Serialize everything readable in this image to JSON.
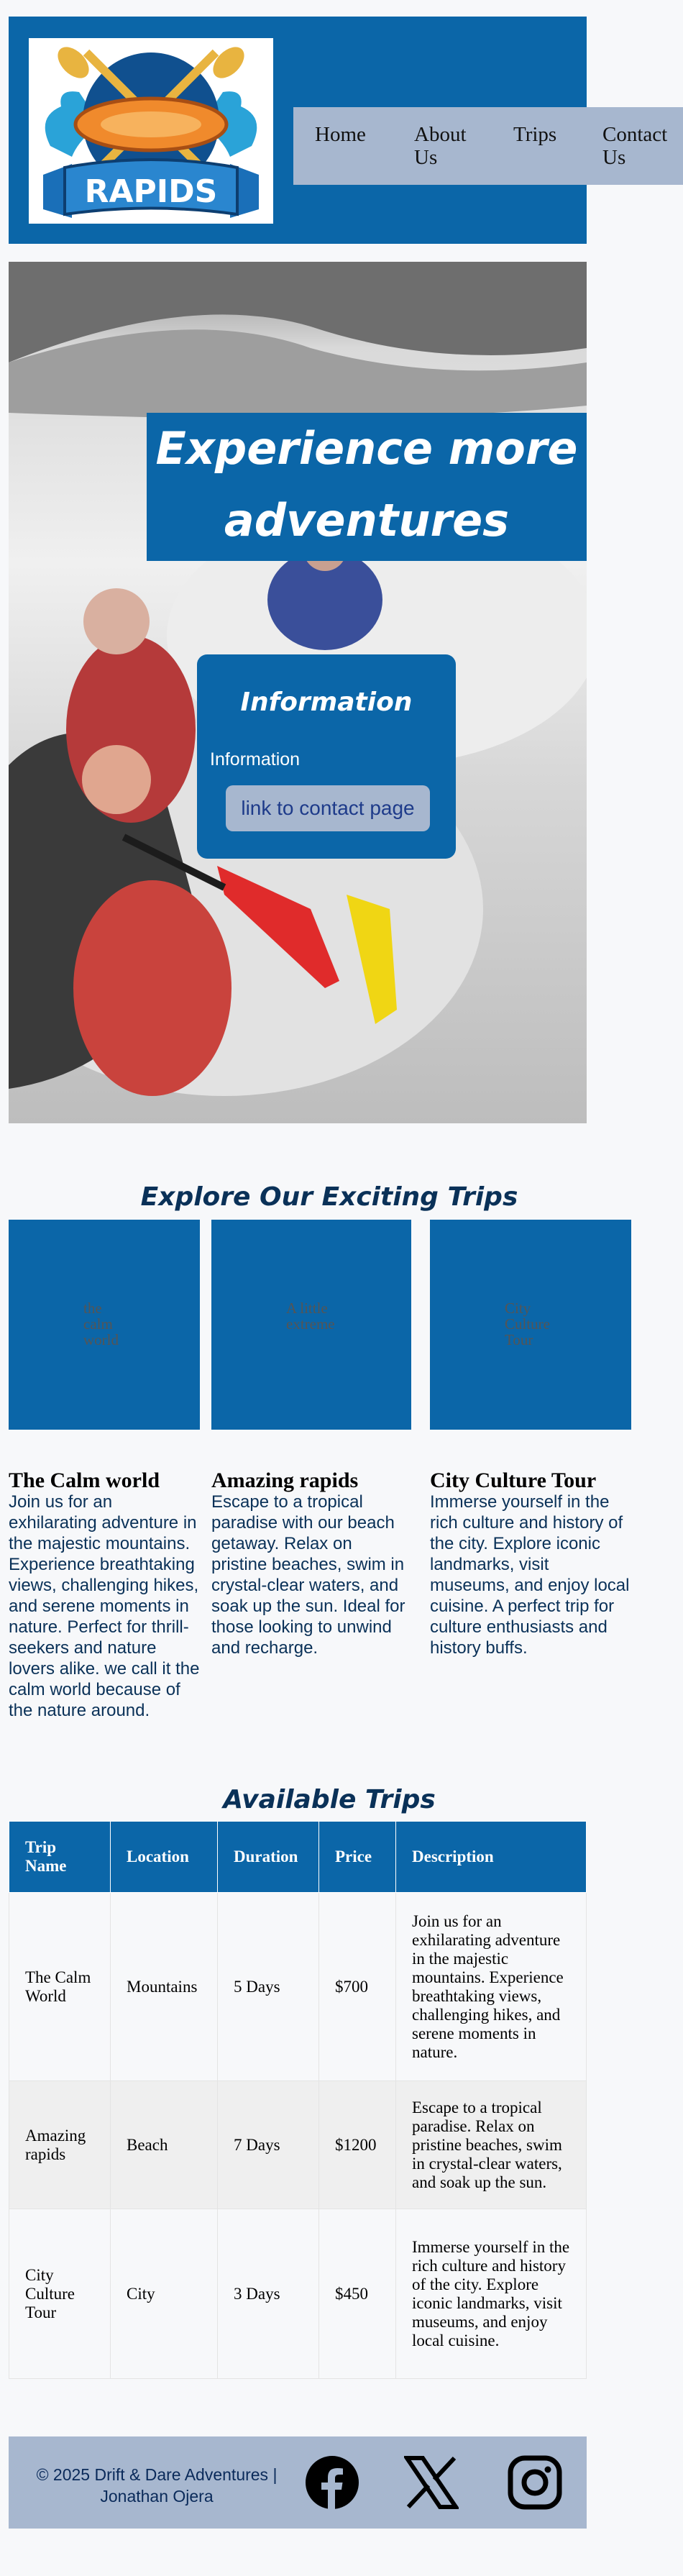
{
  "header": {
    "logo_text": "RAPIDS",
    "nav": [
      "Home",
      "About Us",
      "Trips",
      "Contact Us"
    ]
  },
  "hero": {
    "title": "Experience more adventures",
    "info": {
      "title": "Information",
      "text": "Information",
      "link": "link to contact page"
    }
  },
  "explore": {
    "heading": "Explore Our Exciting Trips",
    "cards": [
      {
        "alt": "the calm world",
        "title": "The Calm world",
        "description": "Join us for an exhilarating adventure in the majestic mountains. Experience breathtaking views, challenging hikes, and serene moments in nature. Perfect for thrill-seekers and nature lovers alike. we call it the calm world because of the nature around."
      },
      {
        "alt": "A little extreme",
        "title": "Amazing rapids",
        "description": "Escape to a tropical paradise with our beach getaway. Relax on pristine beaches, swim in crystal-clear waters, and soak up the sun. Ideal for those looking to unwind and recharge."
      },
      {
        "alt": "City Culture Tour",
        "title": "City Culture Tour",
        "description": "Immerse yourself in the rich culture and history of the city. Explore iconic landmarks, visit museums, and enjoy local cuisine. A perfect trip for culture enthusiasts and history buffs."
      }
    ]
  },
  "trips": {
    "heading": "Available Trips",
    "columns": [
      "Trip Name",
      "Location",
      "Duration",
      "Price",
      "Description"
    ],
    "rows": [
      [
        "The Calm World",
        "Mountains",
        "5 Days",
        "$700",
        "Join us for an exhilarating adventure in the majestic mountains. Experience breathtaking views, challenging hikes, and serene moments in nature."
      ],
      [
        "Amazing rapids",
        "Beach",
        "7 Days",
        "$1200",
        "Escape to a tropical paradise. Relax on pristine beaches, swim in crystal-clear waters, and soak up the sun."
      ],
      [
        "City Culture Tour",
        "City",
        "3 Days",
        "$450",
        "Immerse yourself in the rich culture and history of the city. Explore iconic landmarks, visit museums, and enjoy local cuisine."
      ]
    ]
  },
  "footer": {
    "copyright": "© 2025 Drift & Dare Adventures | Jonathan Ojera",
    "social": [
      "facebook-icon",
      "x-icon",
      "instagram-icon"
    ]
  },
  "colors": {
    "brand_blue": "#0b66a8",
    "nav_bg": "#a7b7cf",
    "heading_navy": "#0a3158"
  }
}
